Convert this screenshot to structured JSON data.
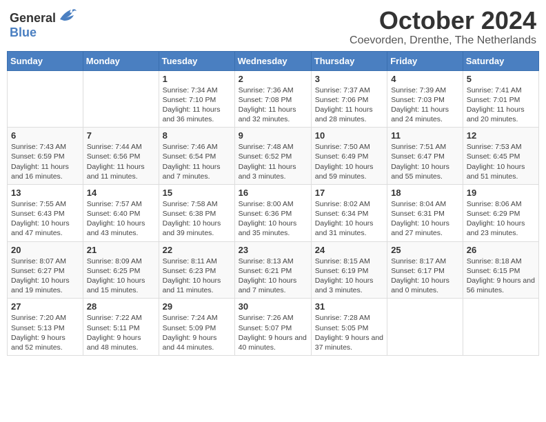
{
  "header": {
    "logo_general": "General",
    "logo_blue": "Blue",
    "month_title": "October 2024",
    "location": "Coevorden, Drenthe, The Netherlands"
  },
  "weekdays": [
    "Sunday",
    "Monday",
    "Tuesday",
    "Wednesday",
    "Thursday",
    "Friday",
    "Saturday"
  ],
  "weeks": [
    [
      {
        "day": "",
        "info": ""
      },
      {
        "day": "",
        "info": ""
      },
      {
        "day": "1",
        "info": "Sunrise: 7:34 AM\nSunset: 7:10 PM\nDaylight: 11 hours and 36 minutes."
      },
      {
        "day": "2",
        "info": "Sunrise: 7:36 AM\nSunset: 7:08 PM\nDaylight: 11 hours and 32 minutes."
      },
      {
        "day": "3",
        "info": "Sunrise: 7:37 AM\nSunset: 7:06 PM\nDaylight: 11 hours and 28 minutes."
      },
      {
        "day": "4",
        "info": "Sunrise: 7:39 AM\nSunset: 7:03 PM\nDaylight: 11 hours and 24 minutes."
      },
      {
        "day": "5",
        "info": "Sunrise: 7:41 AM\nSunset: 7:01 PM\nDaylight: 11 hours and 20 minutes."
      }
    ],
    [
      {
        "day": "6",
        "info": "Sunrise: 7:43 AM\nSunset: 6:59 PM\nDaylight: 11 hours and 16 minutes."
      },
      {
        "day": "7",
        "info": "Sunrise: 7:44 AM\nSunset: 6:56 PM\nDaylight: 11 hours and 11 minutes."
      },
      {
        "day": "8",
        "info": "Sunrise: 7:46 AM\nSunset: 6:54 PM\nDaylight: 11 hours and 7 minutes."
      },
      {
        "day": "9",
        "info": "Sunrise: 7:48 AM\nSunset: 6:52 PM\nDaylight: 11 hours and 3 minutes."
      },
      {
        "day": "10",
        "info": "Sunrise: 7:50 AM\nSunset: 6:49 PM\nDaylight: 10 hours and 59 minutes."
      },
      {
        "day": "11",
        "info": "Sunrise: 7:51 AM\nSunset: 6:47 PM\nDaylight: 10 hours and 55 minutes."
      },
      {
        "day": "12",
        "info": "Sunrise: 7:53 AM\nSunset: 6:45 PM\nDaylight: 10 hours and 51 minutes."
      }
    ],
    [
      {
        "day": "13",
        "info": "Sunrise: 7:55 AM\nSunset: 6:43 PM\nDaylight: 10 hours and 47 minutes."
      },
      {
        "day": "14",
        "info": "Sunrise: 7:57 AM\nSunset: 6:40 PM\nDaylight: 10 hours and 43 minutes."
      },
      {
        "day": "15",
        "info": "Sunrise: 7:58 AM\nSunset: 6:38 PM\nDaylight: 10 hours and 39 minutes."
      },
      {
        "day": "16",
        "info": "Sunrise: 8:00 AM\nSunset: 6:36 PM\nDaylight: 10 hours and 35 minutes."
      },
      {
        "day": "17",
        "info": "Sunrise: 8:02 AM\nSunset: 6:34 PM\nDaylight: 10 hours and 31 minutes."
      },
      {
        "day": "18",
        "info": "Sunrise: 8:04 AM\nSunset: 6:31 PM\nDaylight: 10 hours and 27 minutes."
      },
      {
        "day": "19",
        "info": "Sunrise: 8:06 AM\nSunset: 6:29 PM\nDaylight: 10 hours and 23 minutes."
      }
    ],
    [
      {
        "day": "20",
        "info": "Sunrise: 8:07 AM\nSunset: 6:27 PM\nDaylight: 10 hours and 19 minutes."
      },
      {
        "day": "21",
        "info": "Sunrise: 8:09 AM\nSunset: 6:25 PM\nDaylight: 10 hours and 15 minutes."
      },
      {
        "day": "22",
        "info": "Sunrise: 8:11 AM\nSunset: 6:23 PM\nDaylight: 10 hours and 11 minutes."
      },
      {
        "day": "23",
        "info": "Sunrise: 8:13 AM\nSunset: 6:21 PM\nDaylight: 10 hours and 7 minutes."
      },
      {
        "day": "24",
        "info": "Sunrise: 8:15 AM\nSunset: 6:19 PM\nDaylight: 10 hours and 3 minutes."
      },
      {
        "day": "25",
        "info": "Sunrise: 8:17 AM\nSunset: 6:17 PM\nDaylight: 10 hours and 0 minutes."
      },
      {
        "day": "26",
        "info": "Sunrise: 8:18 AM\nSunset: 6:15 PM\nDaylight: 9 hours and 56 minutes."
      }
    ],
    [
      {
        "day": "27",
        "info": "Sunrise: 7:20 AM\nSunset: 5:13 PM\nDaylight: 9 hours and 52 minutes."
      },
      {
        "day": "28",
        "info": "Sunrise: 7:22 AM\nSunset: 5:11 PM\nDaylight: 9 hours and 48 minutes."
      },
      {
        "day": "29",
        "info": "Sunrise: 7:24 AM\nSunset: 5:09 PM\nDaylight: 9 hours and 44 minutes."
      },
      {
        "day": "30",
        "info": "Sunrise: 7:26 AM\nSunset: 5:07 PM\nDaylight: 9 hours and 40 minutes."
      },
      {
        "day": "31",
        "info": "Sunrise: 7:28 AM\nSunset: 5:05 PM\nDaylight: 9 hours and 37 minutes."
      },
      {
        "day": "",
        "info": ""
      },
      {
        "day": "",
        "info": ""
      }
    ]
  ]
}
